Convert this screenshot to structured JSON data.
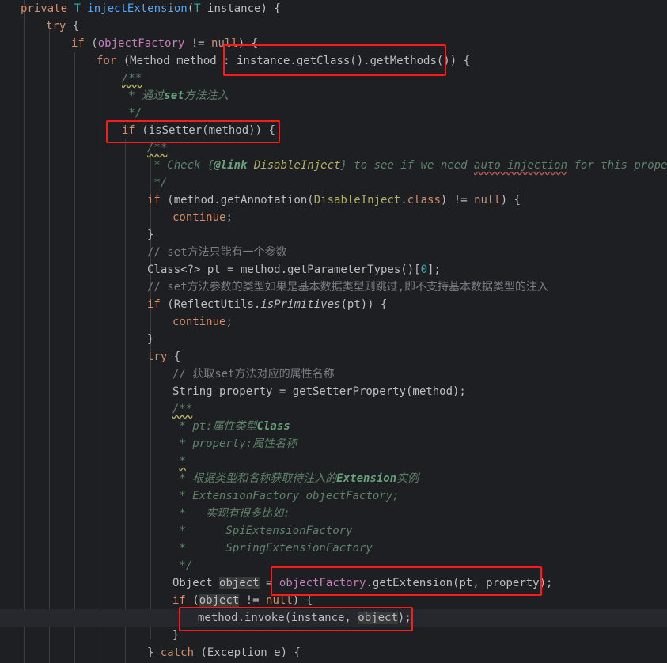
{
  "editor": {
    "lines": [
      [
        [
          "kw",
          "private "
        ],
        [
          "ty",
          "T "
        ],
        [
          "fn",
          "injectExtension"
        ],
        [
          "",
          "("
        ],
        [
          "ty",
          "T "
        ],
        [
          "",
          "instance) {"
        ]
      ],
      [
        [
          "kw",
          "try "
        ],
        [
          "",
          "{"
        ]
      ],
      [
        [
          "kw",
          "if "
        ],
        [
          "",
          "("
        ],
        [
          "fld",
          "objectFactory"
        ],
        [
          "",
          " != "
        ],
        [
          "kw",
          "null"
        ],
        [
          "",
          ") {"
        ]
      ],
      [
        [
          "kw",
          "for "
        ],
        [
          "",
          "(Method method : instance.getClass().getMethods()) {"
        ]
      ],
      [
        [
          "doc squig",
          "/**"
        ]
      ],
      [
        [
          "doc",
          " * 通过"
        ],
        [
          "doctag",
          "set"
        ],
        [
          "doc",
          "方法注入"
        ]
      ],
      [
        [
          "doc",
          " */"
        ]
      ],
      [
        [
          "kw",
          "if "
        ],
        [
          "",
          "("
        ],
        [
          "",
          "isSetter(method)) {"
        ]
      ],
      [
        [
          "doc squig",
          "/**"
        ]
      ],
      [
        [
          "doc",
          " * Check {"
        ],
        [
          "doctag",
          "@link "
        ],
        [
          "doclink",
          "DisableInject"
        ],
        [
          "doc",
          "} to see if we need "
        ],
        [
          "doc typo",
          "auto injection"
        ],
        [
          "doc",
          " for this property"
        ]
      ],
      [
        [
          "doc",
          " */"
        ]
      ],
      [
        [
          "kw",
          "if "
        ],
        [
          "",
          "(method.getAnnotation("
        ],
        [
          "ann",
          "DisableInject"
        ],
        [
          "",
          "."
        ],
        [
          "kw",
          "class"
        ],
        [
          "",
          ") != "
        ],
        [
          "kw",
          "null"
        ],
        [
          "",
          ") {"
        ]
      ],
      [
        [
          "kw",
          "continue"
        ],
        [
          "",
          ";"
        ]
      ],
      [
        [
          "",
          "}"
        ]
      ],
      [
        [
          "com",
          "// set方法只能有一个参数"
        ]
      ],
      [
        [
          "",
          "Class<?> pt = method.getParameterTypes()["
        ],
        [
          "num",
          "0"
        ],
        [
          "",
          "];"
        ]
      ],
      [
        [
          "com",
          "// set方法参数的类型如果是基本数据类型则跳过,即不支持基本数据类型的注入"
        ]
      ],
      [
        [
          "kw",
          "if "
        ],
        [
          "",
          "(ReflectUtils."
        ],
        [
          "it",
          "isPrimitives"
        ],
        [
          "",
          "(pt)) {"
        ]
      ],
      [
        [
          "kw",
          "continue"
        ],
        [
          "",
          ";"
        ]
      ],
      [
        [
          "",
          "}"
        ]
      ],
      [
        [
          "kw",
          "try "
        ],
        [
          "",
          "{"
        ]
      ],
      [
        [
          "com",
          "// 获取set方法对应的属性名称"
        ]
      ],
      [
        [
          "",
          "String property = getSetterProperty(method);"
        ]
      ],
      [
        [
          "doc squig",
          "/**"
        ]
      ],
      [
        [
          "doc",
          " * pt:属性类型"
        ],
        [
          "doctag",
          "Class"
        ]
      ],
      [
        [
          "doc",
          " * property:属性名称"
        ]
      ],
      [
        [
          "doc",
          " "
        ],
        [
          "doc squig",
          "*"
        ]
      ],
      [
        [
          "doc",
          " * 根据类型和名称获取待注入的"
        ],
        [
          "doctag",
          "Extension"
        ],
        [
          "doc",
          "实例"
        ]
      ],
      [
        [
          "doc",
          " * ExtensionFactory objectFactory;"
        ]
      ],
      [
        [
          "doc",
          " *   实现有很多比如:"
        ]
      ],
      [
        [
          "doc",
          " *      SpiExtensionFactory"
        ]
      ],
      [
        [
          "doc",
          " *      SpringExtensionFactory"
        ]
      ],
      [
        [
          "doc",
          " */"
        ]
      ],
      [
        [
          "",
          "Object "
        ],
        [
          "hlvar",
          "object"
        ],
        [
          "",
          " = "
        ],
        [
          "fld",
          "objectFactory"
        ],
        [
          "",
          ".getExtension(pt, property);"
        ]
      ],
      [
        [
          "kw",
          "if "
        ],
        [
          "",
          "("
        ],
        [
          "hlvar",
          "object"
        ],
        [
          "",
          " != "
        ],
        [
          "kw",
          "null"
        ],
        [
          "",
          ") {"
        ]
      ],
      [
        [
          "",
          "method.invoke(instance, "
        ],
        [
          "hlvar",
          "objec"
        ],
        [
          "caret",
          ""
        ],
        [
          "hlvar",
          "t"
        ],
        [
          "",
          ");"
        ]
      ],
      [
        [
          "",
          "}"
        ]
      ],
      [
        [
          "",
          "} "
        ],
        [
          "kw",
          "catch "
        ],
        [
          "",
          "(Exception e) {"
        ]
      ]
    ]
  }
}
